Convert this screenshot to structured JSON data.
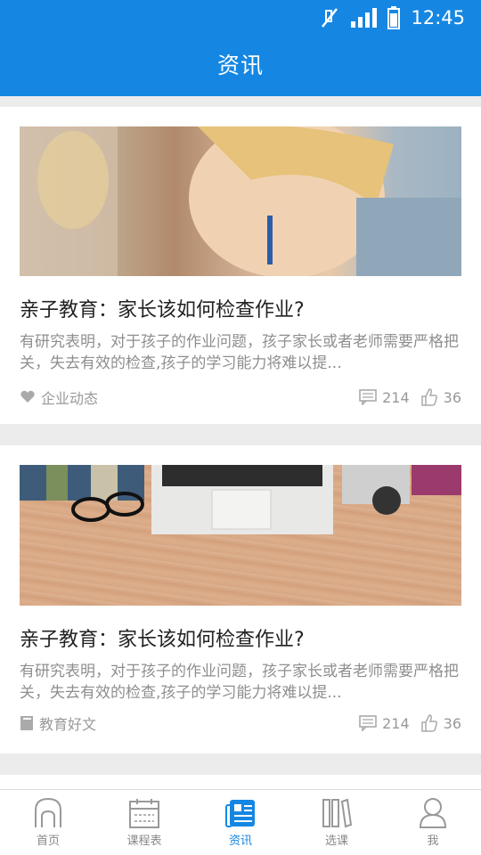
{
  "status_bar": {
    "time": "12:45"
  },
  "header": {
    "title": "资讯"
  },
  "articles": [
    {
      "image": "child-doing-homework-photo",
      "title": "亲子教育：家长该如何检查作业?",
      "summary": "有研究表明，对于孩子的作业问题，孩子家长或者老师需要严格把关，失去有效的检查,孩子的学习能力将难以提...",
      "category": "企业动态",
      "category_icon": "heart-hands-icon",
      "comments": "214",
      "likes": "36"
    },
    {
      "image": "desk-laptop-glasses-camera-photo",
      "title": "亲子教育：家长该如何检查作业?",
      "summary": "有研究表明，对于孩子的作业问题，孩子家长或者老师需要严格把关，失去有效的检查,孩子的学习能力将难以提...",
      "category": "教育好文",
      "category_icon": "book-icon",
      "comments": "214",
      "likes": "36"
    }
  ],
  "tabs": [
    {
      "label": "首页",
      "icon": "home-icon"
    },
    {
      "label": "课程表",
      "icon": "calendar-icon"
    },
    {
      "label": "资讯",
      "icon": "news-icon",
      "active": true
    },
    {
      "label": "选课",
      "icon": "books-icon"
    },
    {
      "label": "我",
      "icon": "person-icon"
    }
  ],
  "colors": {
    "accent": "#1587e3",
    "muted": "#999999",
    "title_text": "#222222"
  }
}
